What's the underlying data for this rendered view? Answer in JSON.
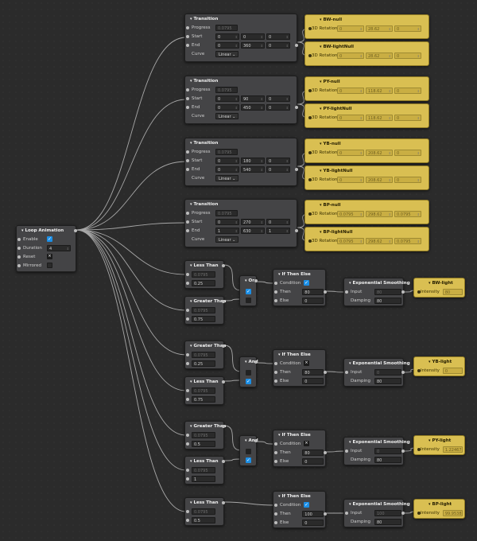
{
  "colors": {
    "canvas": "#2b2b2b",
    "node": "#444446",
    "target_node": "#d9bf52",
    "checkbox_on": "#1c8fe6",
    "wire": "#a7a7a7"
  },
  "loop": {
    "title": "Loop Animation",
    "enable_label": "Enable",
    "enable_checked": true,
    "duration_label": "Duration",
    "duration_value": "4",
    "reset_label": "Reset",
    "mirrored_label": "Mirrored"
  },
  "transitions": [
    {
      "title": "Transition",
      "progress_label": "Progress",
      "progress_value": "0.0795",
      "start_label": "Start",
      "start": [
        "0",
        "0",
        "0"
      ],
      "end_label": "End",
      "end": [
        "0",
        "360",
        "0"
      ],
      "curve_label": "Curve",
      "curve_value": "Linear",
      "targets": [
        {
          "title": "BW-null",
          "prop": "3D Rotation",
          "values": [
            "0",
            "28.62",
            "0"
          ]
        },
        {
          "title": "BW-lightNull",
          "prop": "3D Rotation",
          "values": [
            "0",
            "28.62",
            "0"
          ]
        }
      ]
    },
    {
      "title": "Transition",
      "progress_label": "Progress",
      "progress_value": "0.0795",
      "start_label": "Start",
      "start": [
        "0",
        "90",
        "0"
      ],
      "end_label": "End",
      "end": [
        "0",
        "450",
        "0"
      ],
      "curve_label": "Curve",
      "curve_value": "Linear",
      "targets": [
        {
          "title": "PY-null",
          "prop": "3D Rotation",
          "values": [
            "0",
            "118.62",
            "0"
          ]
        },
        {
          "title": "PY-lightNull",
          "prop": "3D Rotation",
          "values": [
            "0",
            "118.62",
            "0"
          ]
        }
      ]
    },
    {
      "title": "Transition",
      "progress_label": "Progress",
      "progress_value": "0.0795",
      "start_label": "Start",
      "start": [
        "0",
        "180",
        "0"
      ],
      "end_label": "End",
      "end": [
        "0",
        "540",
        "0"
      ],
      "curve_label": "Curve",
      "curve_value": "Linear",
      "targets": [
        {
          "title": "YB-null",
          "prop": "3D Rotation",
          "values": [
            "0",
            "208.62",
            "0"
          ]
        },
        {
          "title": "YB-lightNull",
          "prop": "3D Rotation",
          "values": [
            "0",
            "208.62",
            "0"
          ]
        }
      ]
    },
    {
      "title": "Transition",
      "progress_label": "Progress",
      "progress_value": "0.0795",
      "start_label": "Start",
      "start": [
        "0",
        "270",
        "0"
      ],
      "end_label": "End",
      "end": [
        "1",
        "630",
        "1"
      ],
      "curve_label": "Curve",
      "curve_value": "Linear",
      "targets": [
        {
          "title": "BP-null",
          "prop": "3D Rotation",
          "values": [
            "0.0795",
            "298.62",
            "0.0795"
          ]
        },
        {
          "title": "BP-lightNull",
          "prop": "3D Rotation",
          "values": [
            "0.0795",
            "298.62",
            "0.0795"
          ]
        }
      ]
    }
  ],
  "compares": [
    {
      "title": "Less Than",
      "a": "0.0795",
      "b": "0.25"
    },
    {
      "title": "Greater Than",
      "a": "0.0795",
      "b": "0.75"
    },
    {
      "title": "Greater Than",
      "a": "0.0795",
      "b": "0.25"
    },
    {
      "title": "Less Than",
      "a": "0.0795",
      "b": "0.75"
    },
    {
      "title": "Greater Than",
      "a": "0.0795",
      "b": "0.5"
    },
    {
      "title": "Less Than",
      "a": "0.0795",
      "b": "1"
    },
    {
      "title": "Less Than",
      "a": "0.0795",
      "b": "0.5"
    }
  ],
  "gates": [
    {
      "title": "Or",
      "in1_on": true,
      "in2_on": false
    },
    {
      "title": "And",
      "in1_on": false,
      "in2_on": true
    },
    {
      "title": "And",
      "in1_on": false,
      "in2_on": true
    }
  ],
  "ifs": [
    {
      "title": "If Then Else",
      "cond_label": "Condition",
      "cond_on": true,
      "then_label": "Then",
      "then_value": "80",
      "else_label": "Else",
      "else_value": "0"
    },
    {
      "title": "If Then Else",
      "cond_label": "Condition",
      "cond_on": false,
      "then_label": "Then",
      "then_value": "80",
      "else_label": "Else",
      "else_value": "0"
    },
    {
      "title": "If Then Else",
      "cond_label": "Condition",
      "cond_on": false,
      "then_label": "Then",
      "then_value": "80",
      "else_label": "Else",
      "else_value": "0"
    },
    {
      "title": "If Then Else",
      "cond_label": "Condition",
      "cond_on": true,
      "then_label": "Then",
      "then_value": "100",
      "else_label": "Else",
      "else_value": "0"
    }
  ],
  "smooths": [
    {
      "title": "Exponential Smoothing",
      "input_label": "Input",
      "input_value": "80",
      "damping_label": "Damping",
      "damping_value": "80"
    },
    {
      "title": "Exponential Smoothing",
      "input_label": "Input",
      "input_value": "0",
      "damping_label": "Damping",
      "damping_value": "80"
    },
    {
      "title": "Exponential Smoothing",
      "input_label": "Input",
      "input_value": "0",
      "damping_label": "Damping",
      "damping_value": "80"
    },
    {
      "title": "Exponential Smoothing",
      "input_label": "Input",
      "input_value": "100",
      "damping_label": "Damping",
      "damping_value": "80"
    }
  ],
  "lights": [
    {
      "title": "BW-light",
      "prop": "Intensity",
      "value": "80"
    },
    {
      "title": "YB-light",
      "prop": "Intensity",
      "value": "0"
    },
    {
      "title": "PY-light",
      "prop": "Intensity",
      "value": "1.22467"
    },
    {
      "title": "BP-light",
      "prop": "Intensity",
      "value": "99.95382"
    }
  ]
}
